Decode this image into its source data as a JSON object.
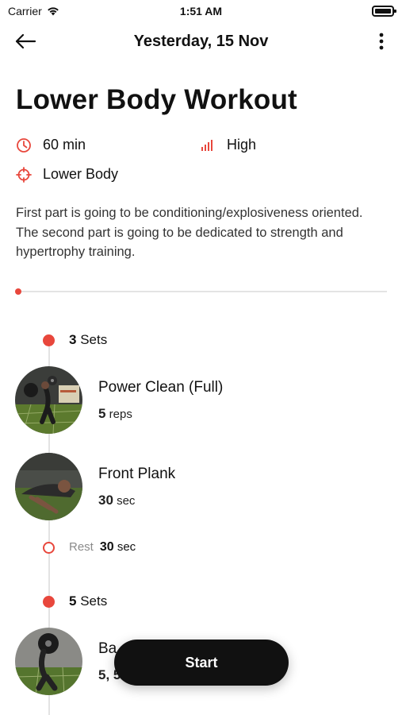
{
  "status_bar": {
    "carrier": "Carrier",
    "time": "1:51 AM"
  },
  "nav": {
    "title": "Yesterday, 15 Nov",
    "back_icon": "arrow-left-icon",
    "more_icon": "more-vertical-icon"
  },
  "workout": {
    "title": "Lower Body Workout",
    "duration": "60 min",
    "intensity": "High",
    "target": "Lower Body",
    "description": "First part is going to be conditioning/explosiveness oriented. The second part is going to be dedicated to strength and hypertrophy training.",
    "progress": 0.0
  },
  "colors": {
    "accent": "#e8473c",
    "text": "#111111",
    "muted": "#8a8a8a",
    "button": "#111111"
  },
  "blocks": [
    {
      "sets_number": "3",
      "sets_label": "Sets",
      "exercises": [
        {
          "name": "Power Clean (Full)",
          "amount": "5",
          "unit": "reps"
        },
        {
          "name": "Front Plank",
          "amount": "30",
          "unit": "sec"
        }
      ],
      "rest": {
        "label": "Rest",
        "amount": "30",
        "unit": "sec"
      }
    },
    {
      "sets_number": "5",
      "sets_label": "Sets",
      "exercises": [
        {
          "name": "Ba",
          "amount": "5, 5",
          "unit": ""
        }
      ]
    }
  ],
  "start_button": {
    "label": "Start"
  }
}
